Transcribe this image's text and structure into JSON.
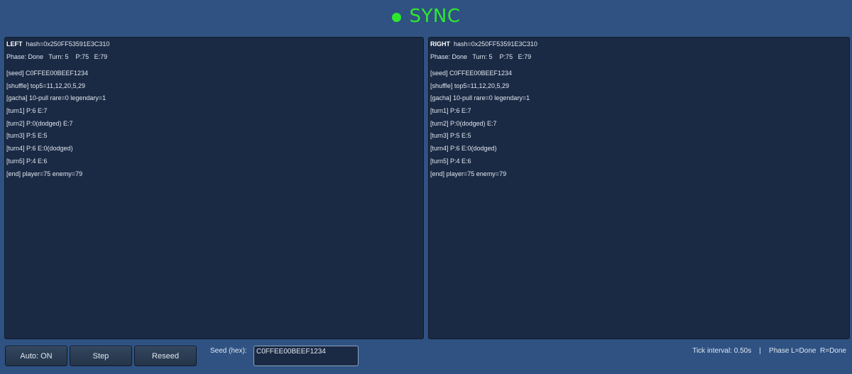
{
  "status": {
    "indicator_color": "#2ee82e",
    "label": "SYNC"
  },
  "panels": {
    "left": {
      "side": "LEFT",
      "hash": "hash=0x250FF53591E3C310",
      "meta": "Phase: Done   Turn: 5    P:75   E:79",
      "log": [
        "[seed] C0FFEE00BEEF1234",
        "[shuffle] top5=11,12,20,5,29",
        "[gacha] 10-pull rare=0 legendary=1",
        "[turn1] P:6 E:7",
        "[turn2] P:0(dodged) E:7",
        "[turn3] P:5 E:5",
        "[turn4] P:6 E:0(dodged)",
        "[turn5] P:4 E:6",
        "[end] player=75 enemy=79"
      ]
    },
    "right": {
      "side": "RIGHT",
      "hash": "hash=0x250FF53591E3C310",
      "meta": "Phase: Done   Turn: 5    P:75   E:79",
      "log": [
        "[seed] C0FFEE00BEEF1234",
        "[shuffle] top5=11,12,20,5,29",
        "[gacha] 10-pull rare=0 legendary=1",
        "[turn1] P:6 E:7",
        "[turn2] P:0(dodged) E:7",
        "[turn3] P:5 E:5",
        "[turn4] P:6 E:0(dodged)",
        "[turn5] P:4 E:6",
        "[end] player=75 enemy=79"
      ]
    }
  },
  "controls": {
    "auto_label": "Auto: ON",
    "step_label": "Step",
    "reseed_label": "Reseed",
    "seed_label": "Seed (hex):",
    "seed_value": "C0FFEE00BEEF1234"
  },
  "footer": {
    "status": "Tick interval: 0.50s    |    Phase L=Done  R=Done"
  }
}
